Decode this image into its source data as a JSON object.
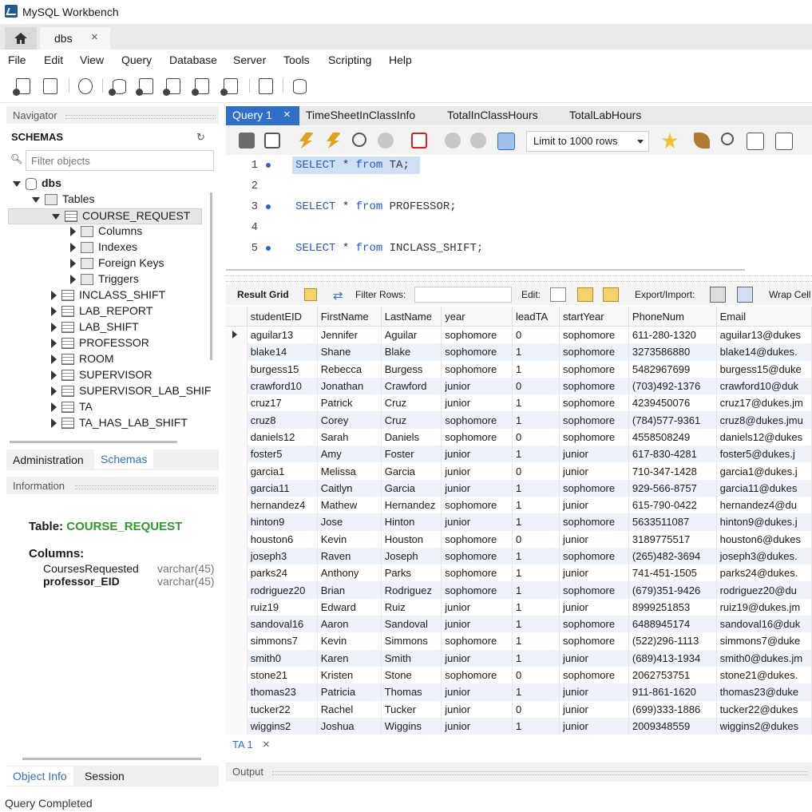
{
  "window": {
    "title": "MySQL Workbench"
  },
  "tabs": {
    "home_icon": "home-icon",
    "connection": "dbs",
    "close": "×"
  },
  "menu": [
    "File",
    "Edit",
    "View",
    "Query",
    "Database",
    "Server",
    "Tools",
    "Scripting",
    "Help"
  ],
  "navigator": {
    "header": "Navigator",
    "schemas_label": "SCHEMAS",
    "refresh_icon": "↻",
    "filter_placeholder": "Filter objects",
    "schema": "dbs",
    "tables_label": "Tables",
    "expanded_table": "COURSE_REQUEST",
    "sub_items": [
      "Columns",
      "Indexes",
      "Foreign Keys",
      "Triggers"
    ],
    "tables": [
      "INCLASS_SHIFT",
      "LAB_REPORT",
      "LAB_SHIFT",
      "PROFESSOR",
      "ROOM",
      "SUPERVISOR",
      "SUPERVISOR_LAB_SHIF",
      "TA",
      "TA_HAS_LAB_SHIFT"
    ]
  },
  "left_tabs": {
    "administration": "Administration",
    "schemas": "Schemas"
  },
  "information": {
    "header": "Information",
    "table_label": "Table:",
    "table_name": "COURSE_REQUEST",
    "columns_label": "Columns:",
    "columns": [
      {
        "name": "CoursesRequested",
        "type": "varchar(45)"
      },
      {
        "name": "professor_EID",
        "type": "varchar(45)"
      }
    ]
  },
  "bottom_left_tabs": {
    "object_info": "Object Info",
    "session": "Session"
  },
  "query_tabs": {
    "active": "Query 1",
    "close": "×",
    "others": [
      "TimeSheetInClassInfo",
      "TotalInClassHours",
      "TotalLabHours"
    ]
  },
  "query_toolbar": {
    "limit": "Limit to 1000 rows"
  },
  "editor": {
    "lines": [
      {
        "n": "1",
        "kw1": "SELECT",
        "mid": " * ",
        "kw2": "from",
        "rest": " TA;"
      },
      {
        "n": "2"
      },
      {
        "n": "3",
        "kw1": "SELECT",
        "mid": " * ",
        "kw2": "from",
        "rest": " PROFESSOR;"
      },
      {
        "n": "4"
      },
      {
        "n": "5",
        "kw1": "SELECT",
        "mid": " * ",
        "kw2": "from",
        "rest": " INCLASS_SHIFT;"
      }
    ]
  },
  "result_toolbar": {
    "result_grid": "Result Grid",
    "filter_rows": "Filter Rows:",
    "edit": "Edit:",
    "export": "Export/Import:",
    "wrap": "Wrap Cell"
  },
  "grid": {
    "columns": [
      "studentEID",
      "FirstName",
      "LastName",
      "year",
      "leadTA",
      "startYear",
      "PhoneNum",
      "Email"
    ],
    "rows": [
      [
        "aguilar13",
        "Jennifer",
        "Aguilar",
        "sophomore",
        "0",
        "sophomore",
        "611-280-1320",
        "aguilar13@dukes"
      ],
      [
        "blake14",
        "Shane",
        "Blake",
        "sophomore",
        "1",
        "sophomore",
        "3273586880",
        "blake14@dukes."
      ],
      [
        "burgess15",
        "Rebecca",
        "Burgess",
        "sophomore",
        "1",
        "sophomore",
        "5482967699",
        "burgess15@duke"
      ],
      [
        "crawford10",
        "Jonathan",
        "Crawford",
        "junior",
        "0",
        "sophomore",
        "(703)492-1376",
        "crawford10@duk"
      ],
      [
        "cruz17",
        "Patrick",
        "Cruz",
        "junior",
        "1",
        "sophomore",
        "4239450076",
        "cruz17@dukes.jm"
      ],
      [
        "cruz8",
        "Corey",
        "Cruz",
        "sophomore",
        "1",
        "sophomore",
        "(784)577-9361",
        "cruz8@dukes.jmu"
      ],
      [
        "daniels12",
        "Sarah",
        "Daniels",
        "sophomore",
        "0",
        "sophomore",
        "4558508249",
        "daniels12@dukes"
      ],
      [
        "foster5",
        "Amy",
        "Foster",
        "junior",
        "1",
        "junior",
        "617-830-4281",
        "foster5@dukes.j"
      ],
      [
        "garcia1",
        "Melissa",
        "Garcia",
        "junior",
        "0",
        "junior",
        "710-347-1428",
        "garcia1@dukes.j"
      ],
      [
        "garcia11",
        "Caitlyn",
        "Garcia",
        "junior",
        "1",
        "sophomore",
        "929-566-8757",
        "garcia11@dukes"
      ],
      [
        "hernandez4",
        "Mathew",
        "Hernandez",
        "sophomore",
        "1",
        "junior",
        "615-790-0422",
        "hernandez4@du"
      ],
      [
        "hinton9",
        "Jose",
        "Hinton",
        "junior",
        "1",
        "sophomore",
        "5633511087",
        "hinton9@dukes.j"
      ],
      [
        "houston6",
        "Kevin",
        "Houston",
        "sophomore",
        "0",
        "junior",
        "3189775517",
        "houston6@dukes"
      ],
      [
        "joseph3",
        "Raven",
        "Joseph",
        "sophomore",
        "1",
        "sophomore",
        "(265)482-3694",
        "joseph3@dukes."
      ],
      [
        "parks24",
        "Anthony",
        "Parks",
        "sophomore",
        "1",
        "junior",
        "741-451-1505",
        "parks24@dukes."
      ],
      [
        "rodriguez20",
        "Brian",
        "Rodriguez",
        "sophomore",
        "1",
        "sophomore",
        "(679)351-9426",
        "rodriguez20@du"
      ],
      [
        "ruiz19",
        "Edward",
        "Ruiz",
        "junior",
        "1",
        "junior",
        "8999251853",
        "ruiz19@dukes.jm"
      ],
      [
        "sandoval16",
        "Aaron",
        "Sandoval",
        "junior",
        "1",
        "sophomore",
        "6488945174",
        "sandoval16@duk"
      ],
      [
        "simmons7",
        "Kevin",
        "Simmons",
        "sophomore",
        "1",
        "sophomore",
        "(522)296-1113",
        "simmons7@duke"
      ],
      [
        "smith0",
        "Karen",
        "Smith",
        "junior",
        "1",
        "junior",
        "(689)413-1934",
        "smith0@dukes.jm"
      ],
      [
        "stone21",
        "Kristen",
        "Stone",
        "sophomore",
        "0",
        "sophomore",
        "2062753751",
        "stone21@dukes."
      ],
      [
        "thomas23",
        "Patricia",
        "Thomas",
        "junior",
        "1",
        "junior",
        "911-861-1620",
        "thomas23@duke"
      ],
      [
        "tucker22",
        "Rachel",
        "Tucker",
        "junior",
        "0",
        "junior",
        "(699)333-1886",
        "tucker22@dukes"
      ],
      [
        "wiggins2",
        "Joshua",
        "Wiggins",
        "junior",
        "1",
        "junior",
        "2009348559",
        "wiggins2@dukes"
      ]
    ]
  },
  "result_tabs": {
    "active": "TA 1",
    "close": "×"
  },
  "output": {
    "header": "Output"
  },
  "status": {
    "text": "Query Completed"
  },
  "colors": {
    "accent": "#2f6fc8",
    "schema_green": "#2a9a2a",
    "keyword": "#2857c8"
  }
}
